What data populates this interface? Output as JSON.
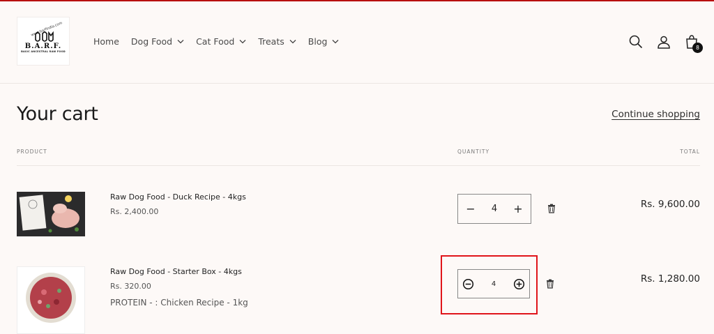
{
  "header": {
    "logo": {
      "site_text": "www.barfindia.com",
      "brand": "B.A.R.F.",
      "tagline": "BASIC ANCESTRAL RAW FOOD"
    },
    "nav": [
      {
        "label": "Home",
        "has_dropdown": false
      },
      {
        "label": "Dog Food",
        "has_dropdown": true
      },
      {
        "label": "Cat Food",
        "has_dropdown": true
      },
      {
        "label": "Treats",
        "has_dropdown": true
      },
      {
        "label": "Blog",
        "has_dropdown": true
      }
    ],
    "icons": [
      "search-icon",
      "account-icon",
      "cart-icon"
    ],
    "cart_count": "8"
  },
  "cart": {
    "title": "Your cart",
    "continue_label": "Continue shopping",
    "columns": {
      "product": "PRODUCT",
      "quantity": "QUANTITY",
      "total": "TOTAL"
    },
    "items": [
      {
        "name": "Raw Dog Food - Duck Recipe - 4kgs",
        "price": "Rs. 2,400.00",
        "option": "",
        "quantity": "4",
        "total": "Rs. 9,600.00"
      },
      {
        "name": "Raw Dog Food - Starter Box - 4kgs",
        "price": "Rs. 320.00",
        "option": "PROTEIN - : Chicken Recipe - 1kg",
        "quantity": "4",
        "total": "Rs. 1,280.00"
      }
    ]
  },
  "colors": {
    "accent_bar": "#b80f0f",
    "highlight": "#e0141a",
    "background": "#fdf9f7"
  }
}
